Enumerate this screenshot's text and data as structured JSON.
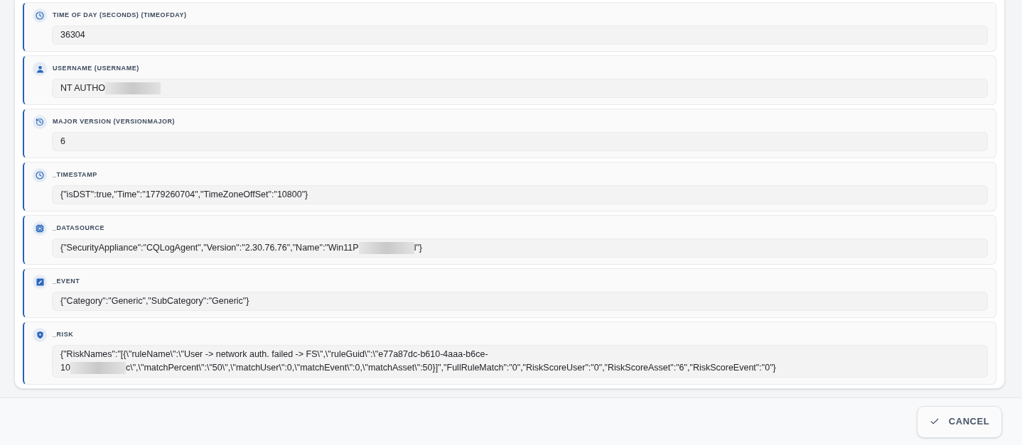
{
  "fields": [
    {
      "kind": "time",
      "label": "TIME OF DAY (SECONDS) (TIMEOFDAY)",
      "value_lines": [
        [
          {
            "kind": "text",
            "text": "36304"
          }
        ]
      ]
    },
    {
      "kind": "user",
      "label": "USERNAME (USERNAME)",
      "value_lines": [
        [
          {
            "kind": "text",
            "text": "NT AUTHO"
          },
          {
            "kind": "redacted"
          }
        ]
      ]
    },
    {
      "kind": "version",
      "label": "MAJOR VERSION (VERSIONMAJOR)",
      "value_lines": [
        [
          {
            "kind": "text",
            "text": "6"
          }
        ]
      ]
    },
    {
      "kind": "time",
      "label": "_TIMESTAMP",
      "value_lines": [
        [
          {
            "kind": "text",
            "text": "{\"isDST\":true,\"Time\":\"1779260704\",\"TimeZoneOffSet\":\"10800\"}"
          }
        ]
      ]
    },
    {
      "kind": "source",
      "label": "_DATASOURCE",
      "value_lines": [
        [
          {
            "kind": "text",
            "text": "{\"SecurityAppliance\":\"CQLogAgent\",\"Version\":\"2.30.76.76\",\"Name\":\"Win11P"
          },
          {
            "kind": "redacted"
          },
          {
            "kind": "text",
            "text": "l\"}"
          }
        ]
      ]
    },
    {
      "kind": "event",
      "label": "_EVENT",
      "value_lines": [
        [
          {
            "kind": "text",
            "text": "{\"Category\":\"Generic\",\"SubCategory\":\"Generic\"}"
          }
        ]
      ]
    },
    {
      "kind": "risk",
      "label": "_RISK",
      "value_lines": [
        [
          {
            "kind": "text",
            "text": "{\"RiskNames\":\"[{\\\"ruleName\\\":\\\"User -> network auth. failed -> FS\\\",\\\"ruleGuid\\\":\\\"e77a87dc-b610-4aaa-b6ce-"
          }
        ],
        [
          {
            "kind": "text",
            "text": "10"
          },
          {
            "kind": "redacted"
          },
          {
            "kind": "text",
            "text": "c\\\",\\\"matchPercent\\\":\\\"50\\\",\\\"matchUser\\\":0,\\\"matchEvent\\\":0,\\\"matchAsset\\\":50}]\",\"FullRuleMatch\":\"0\",\"RiskScoreUser\":\"0\",\"RiskScoreAsset\":\"6\",\"RiskScoreEvent\":\"0\"}"
          }
        ]
      ]
    }
  ],
  "footer": {
    "buttons": [
      {
        "label": "CANCEL"
      }
    ]
  }
}
